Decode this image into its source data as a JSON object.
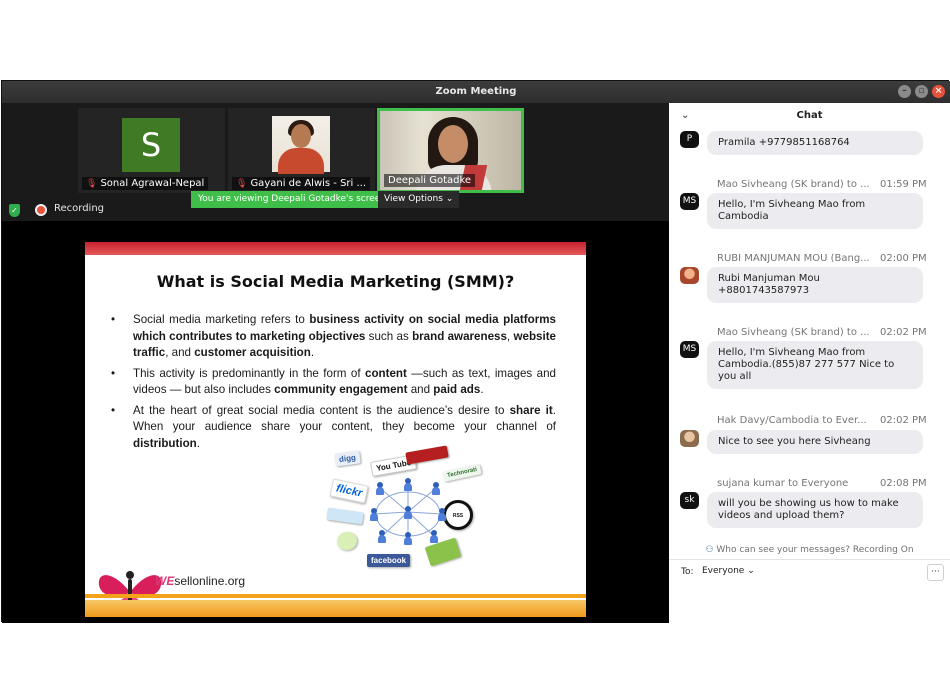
{
  "window": {
    "title": "Zoom Meeting"
  },
  "participants": [
    {
      "name": "Sonal Agrawal-Nepal",
      "avatar_letter": "S",
      "avatar_color": "#3f7a24",
      "muted": true
    },
    {
      "name": "Gayani de Alwis  - Sri ...",
      "muted": true
    },
    {
      "name": "Deepali Gotadke",
      "muted": false,
      "active_speaker": true
    }
  ],
  "status": {
    "recording_label": "Recording",
    "viewing_banner": "You are viewing Deepali Gotadke's screen",
    "view_options_label": "View Options"
  },
  "slide": {
    "title": "What is Social Media Marketing (SMM)?",
    "bullet1": {
      "t1": "Social media marketing refers to ",
      "b1": "business activity on social media platforms which contributes to marketing objectives",
      "t2": " such as ",
      "b2": "brand awareness",
      "t3": ", ",
      "b3": "website traffic",
      "t4": ", and ",
      "b4": "customer acquisition",
      "t5": "."
    },
    "bullet2": {
      "t1": "This activity is predominantly in the form of ",
      "b1": "content",
      "t2": " —such as text, images and videos — but also includes ",
      "b2": "community engagement",
      "t3": " and ",
      "b3": "paid ads",
      "t4": "."
    },
    "bullet3": {
      "t1": "At the heart of great social media content is the audience’s desire to ",
      "b1": "share it",
      "t2": ". When your audience share your content, they become your channel of ",
      "b2": "distribution",
      "t3": "."
    },
    "graphic_logos": [
      "digg",
      "You Tube",
      "Technorati",
      "flickr",
      "facebook",
      "RSS"
    ],
    "brand": {
      "w": "WE",
      "rest": "sellonline.org"
    }
  },
  "chat": {
    "title": "Chat",
    "messages": [
      {
        "avatar": "P",
        "sender": "",
        "time": "",
        "text": "Pramila +9779851168764"
      },
      {
        "avatar": "MS",
        "sender": "Mao Sivheang (SK brand) to ...",
        "time": "01:59 PM",
        "text": "Hello, I'm Sivheang Mao from Cambodia"
      },
      {
        "avatar": "",
        "sender": "RUBI MANJUMAN MOU (Bang...",
        "time": "02:00 PM",
        "text": "Rubi Manjuman Mou +8801743587973"
      },
      {
        "avatar": "MS",
        "sender": "Mao Sivheang (SK brand) to ...",
        "time": "02:02 PM",
        "text": "Hello, I'm Sivheang Mao from Cambodia.(855)87 277 577 Nice to you all"
      },
      {
        "avatar": "",
        "sender": "Hak Davy/Cambodia to Ever...",
        "time": "02:02 PM",
        "text": "Nice to see you here Sivheang"
      },
      {
        "avatar": "sk",
        "sender": "sujana kumar to Everyone",
        "time": "02:08 PM",
        "text": "will you be showing us how to make videos and upload them?"
      }
    ],
    "privacy_note": "Who can see your messages? Recording On",
    "to_label": "To:",
    "to_value": "Everyone",
    "more_label": "···"
  }
}
